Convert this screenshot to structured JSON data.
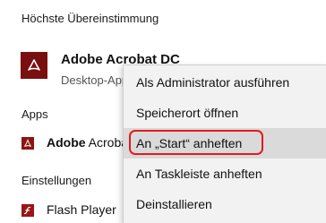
{
  "best_match": {
    "section_title": "Höchste Übereinstimmung",
    "title": "Adobe Acrobat DC",
    "subtitle": "Desktop-App",
    "icon": "adobe-acrobat-icon",
    "icon_color": "#7a0f10"
  },
  "apps": {
    "section_title": "Apps",
    "items": [
      {
        "label_bold": "Adobe",
        "label_rest": " Acrobat",
        "icon": "adobe-acrobat-icon"
      }
    ]
  },
  "settings": {
    "section_title": "Einstellungen",
    "items": [
      {
        "label": "Flash Player",
        "icon": "flash-player-icon"
      }
    ]
  },
  "context_menu": {
    "items": [
      {
        "label": "Als Administrator ausführen"
      },
      {
        "label": "Speicherort öffnen"
      },
      {
        "label": "An „Start“ anheften",
        "highlighted": true
      },
      {
        "label": "An Taskleiste anheften"
      },
      {
        "label": "Deinstallieren"
      }
    ],
    "highlight_color": "#e21b1b"
  }
}
